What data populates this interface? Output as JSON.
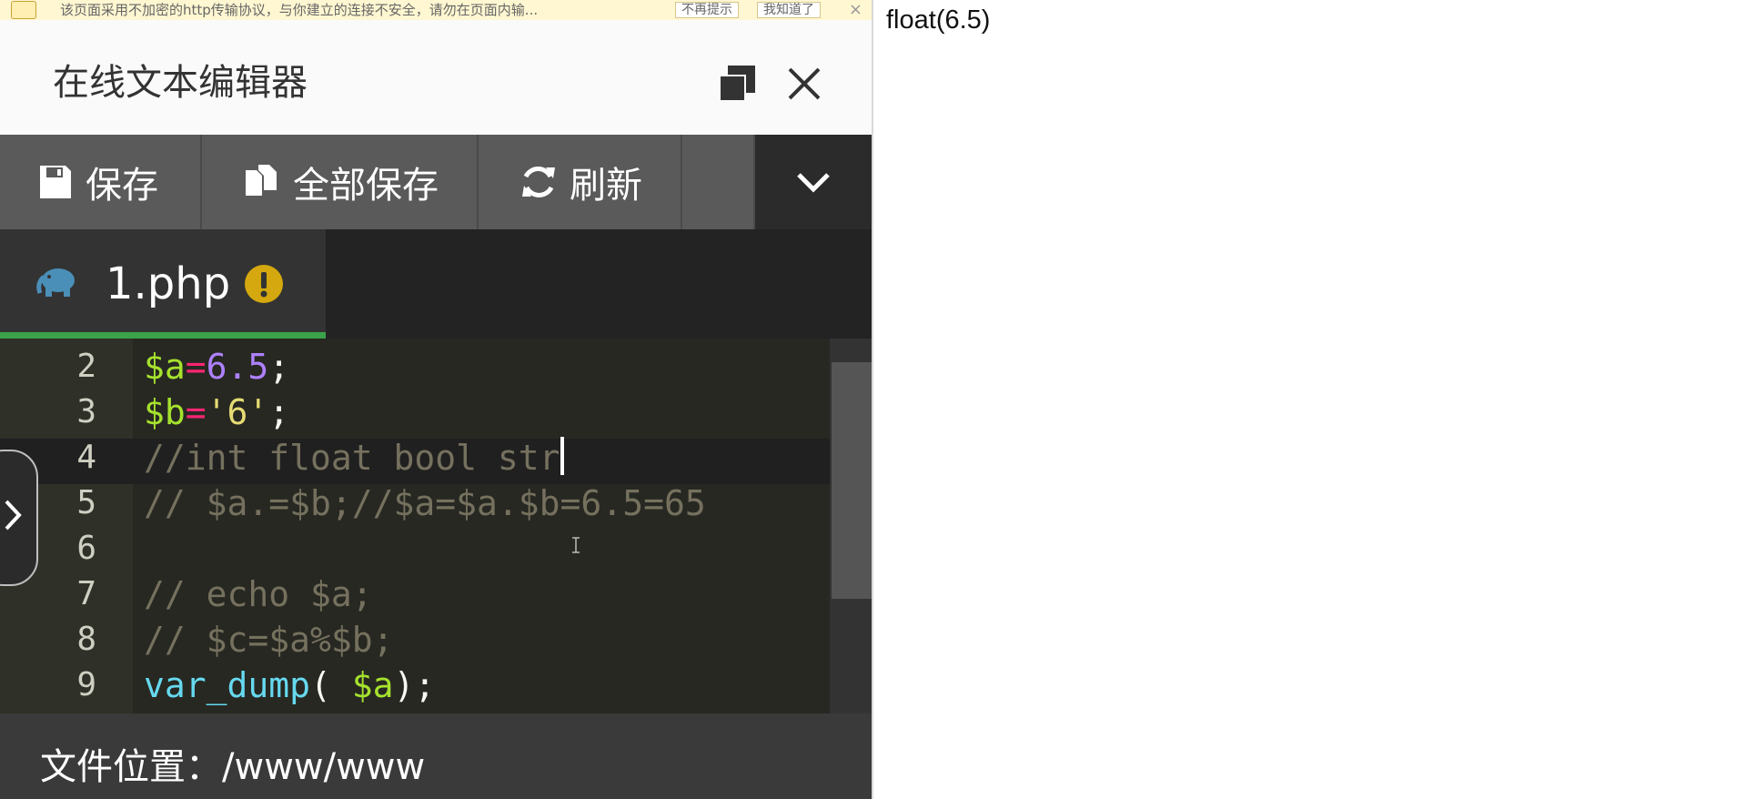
{
  "notice": {
    "message": "该页面采用不加密的http传输协议，与你建立的连接不安全，请勿在页面内输...",
    "btn_never": "不再提示",
    "btn_ok": "我知道了",
    "close": "×"
  },
  "titlebar": {
    "title": "在线文本编辑器"
  },
  "toolbar": {
    "save_label": "保存",
    "save_all_label": "全部保存",
    "refresh_label": "刷新"
  },
  "tab": {
    "filename": "1.php"
  },
  "editor": {
    "line_numbers": [
      "2",
      "3",
      "4",
      "5",
      "6",
      "7",
      "8",
      "9"
    ],
    "lines": {
      "l2": {
        "var": "$a",
        "op": "=",
        "num": "6.5",
        "end": ";"
      },
      "l3": {
        "var": "$b",
        "op": "=",
        "str": "'6'",
        "end": ";"
      },
      "l4": {
        "comment": "//int float bool str"
      },
      "l5": {
        "comment": "// $a.=$b;//$a=$a.$b=6.5=65"
      },
      "l6": {
        "comment": ""
      },
      "l7": {
        "comment": "// echo $a;"
      },
      "l8": {
        "comment": "// $c=$a%$b;"
      },
      "l9": {
        "func": "var_dump",
        "open": "( ",
        "var": "$a",
        "close": ");"
      }
    }
  },
  "footer": {
    "path": "文件位置：/www/www"
  },
  "output": {
    "text": "float(6.5)"
  },
  "colors": {
    "editor_bg": "#272822",
    "variable": "#a6e22e",
    "operator": "#f92672",
    "number": "#ae81ff",
    "string": "#e6db74",
    "comment": "#75715e",
    "function": "#66d9ef",
    "tab_active_underline": "#3aa24a"
  }
}
